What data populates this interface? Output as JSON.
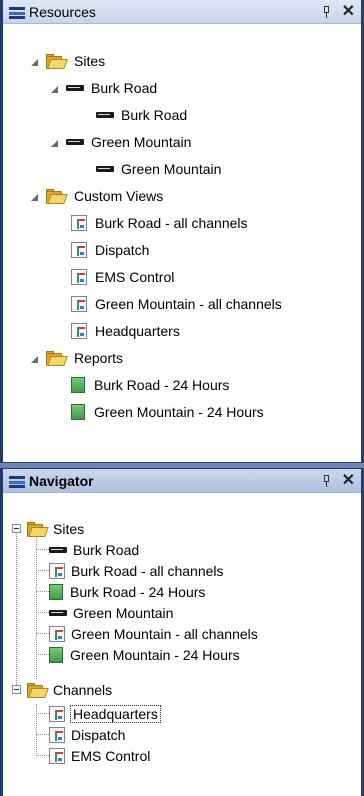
{
  "resources": {
    "title": "Resources",
    "tree": {
      "sites_folder": "Sites",
      "site1": "Burk Road",
      "site1_child": "Burk Road",
      "site2": "Green Mountain",
      "site2_child": "Green Mountain",
      "custom_views_folder": "Custom Views",
      "views": [
        "Burk Road - all channels",
        "Dispatch",
        "EMS Control",
        "Green Mountain - all channels",
        "Headquarters"
      ],
      "reports_folder": "Reports",
      "reports": [
        "Burk Road - 24 Hours",
        "Green Mountain - 24 Hours"
      ]
    }
  },
  "navigator": {
    "title": "Navigator",
    "sites_folder": "Sites",
    "sites_items": [
      "Burk Road",
      "Burk Road - all channels",
      "Burk Road - 24 Hours",
      "Green Mountain",
      "Green Mountain - all channels",
      "Green Mountain - 24 Hours"
    ],
    "channels_folder": "Channels",
    "channels_items": [
      "Headquarters",
      "Dispatch",
      "EMS Control"
    ],
    "selected": "Headquarters"
  },
  "icons": {
    "pin": "pin-icon",
    "close": "close-icon",
    "folder": "folder-icon",
    "site": "site-icon",
    "view": "custom-view-icon",
    "report": "report-icon"
  },
  "colors": {
    "title_bar": "#c7d6ec",
    "divider": "#6d86b8",
    "folder": "#e0a72a",
    "report": "#3f9a44"
  }
}
